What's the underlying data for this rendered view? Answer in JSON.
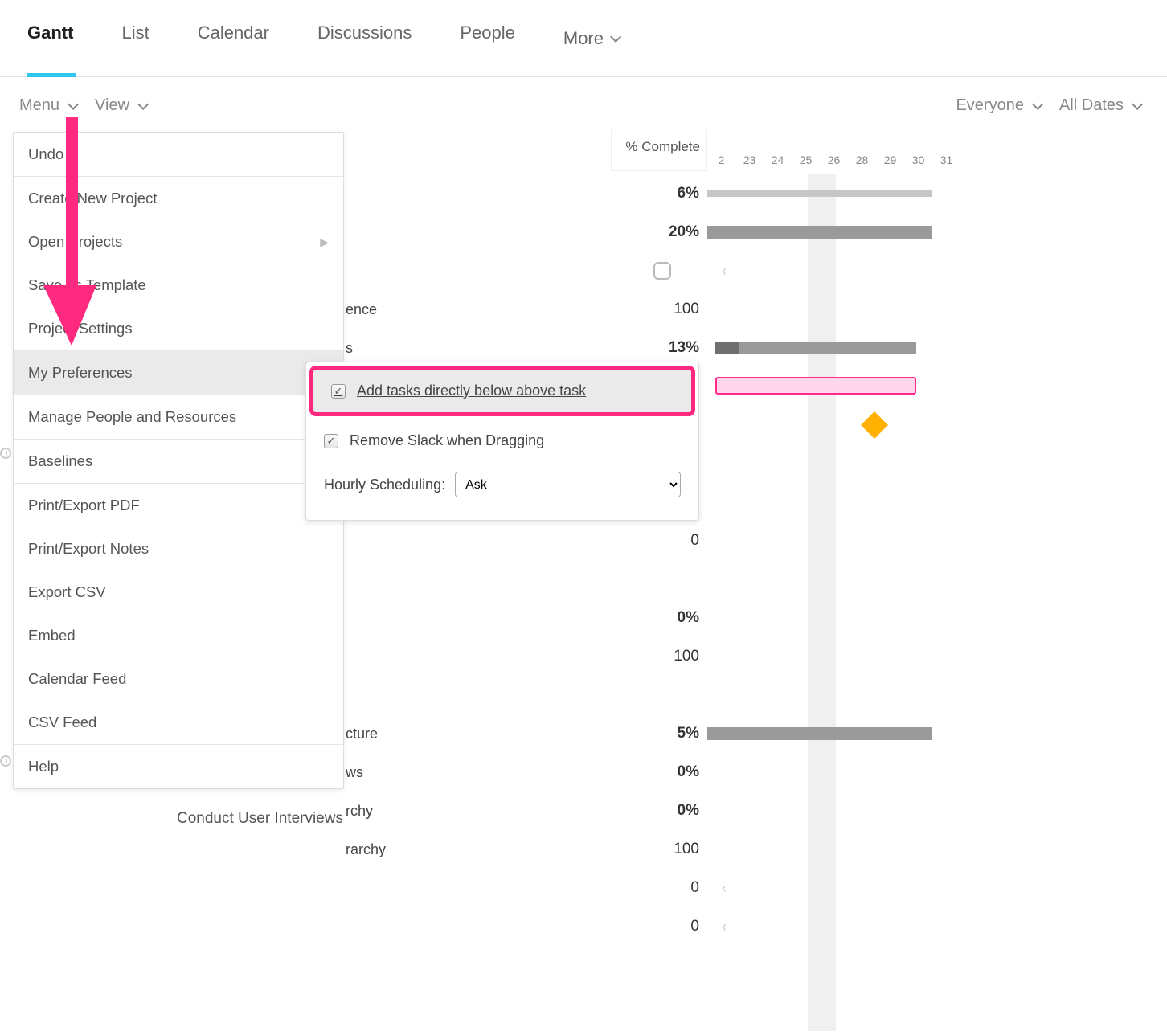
{
  "tabs": {
    "gantt": "Gantt",
    "list": "List",
    "calendar": "Calendar",
    "discussions": "Discussions",
    "people": "People",
    "more": "More"
  },
  "toolbar": {
    "menu": "Menu",
    "view": "View",
    "everyone": "Everyone",
    "all_dates": "All Dates"
  },
  "columns": {
    "complete": "% Complete"
  },
  "dates": [
    "2",
    "23",
    "24",
    "25",
    "26",
    "28",
    "29",
    "30",
    "31"
  ],
  "menu": {
    "undo": "Undo",
    "create_project": "Create New Project",
    "open_projects": "Open Projects",
    "save_template": "Save as Template",
    "project_settings": "Project Settings",
    "my_preferences": "My Preferences",
    "manage_people": "Manage People and Resources",
    "baselines": "Baselines",
    "print_pdf": "Print/Export PDF",
    "print_notes": "Print/Export Notes",
    "export_csv": "Export CSV",
    "embed": "Embed",
    "calendar_feed": "Calendar Feed",
    "csv_feed": "CSV Feed",
    "help": "Help"
  },
  "prefs": {
    "add_below": "Add tasks directly below above task",
    "remove_slack": "Remove Slack when Dragging",
    "hourly_label": "Hourly Scheduling:",
    "hourly_value": "Ask"
  },
  "rows": {
    "r1_pct": "6%",
    "r2_pct": "20%",
    "r3_label": "ence",
    "r3_pct": "100",
    "r4_label": "s",
    "r4_pct": "13%",
    "r9_pct": "0",
    "r11_pct": "0%",
    "r12_pct": "100",
    "r15_label": "cture",
    "r15_pct": "5%",
    "r16_label": "ws",
    "r16_pct": "0%",
    "r17_label": "rchy",
    "r17_pct": "0%",
    "r18_label": "rarchy",
    "r18_pct": "100",
    "r19_pct": "0",
    "r20_pct": "0"
  },
  "peek": "Conduct User Interviews"
}
